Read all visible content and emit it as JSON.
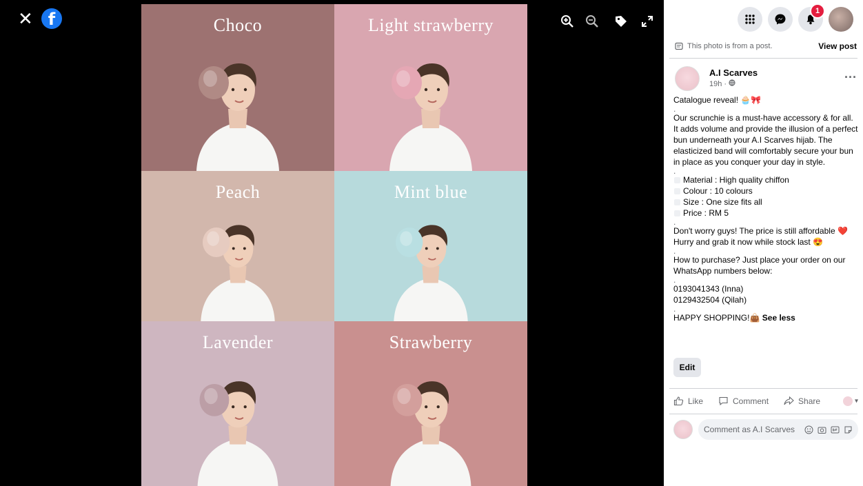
{
  "viewer": {
    "close_icon": "close-icon",
    "logo_icon": "facebook-logo",
    "logo_letter": "f",
    "tools": [
      "zoom-in-icon",
      "zoom-out-icon",
      "tag-icon",
      "fullscreen-icon"
    ]
  },
  "photo": {
    "tiles": [
      {
        "label": "Choco",
        "bg": "#9d7271",
        "scarf": "#b08a85"
      },
      {
        "label": "Light strawberry",
        "bg": "#d9a6b0",
        "scarf": "#e5a7b4"
      },
      {
        "label": "Peach",
        "bg": "#d2b7ac",
        "scarf": "#e6cbc0"
      },
      {
        "label": "Mint blue",
        "bg": "#b7dadc",
        "scarf": "#b9dfe2"
      },
      {
        "label": "Lavender",
        "bg": "#ceb6c0",
        "scarf": "#bc9ea6"
      },
      {
        "label": "Strawberry",
        "bg": "#c9908f",
        "scarf": "#d39f9c"
      }
    ]
  },
  "header": {
    "notification_count": "1"
  },
  "post": {
    "notice": "This photo is from a post.",
    "view_post": "View post",
    "author": "A.I Scarves",
    "time": "19h ·",
    "more": "···",
    "headline": "Catalogue reveal! 🧁🎀",
    "dot": ".",
    "description": "Our scrunchie is a must-have accessory & for all. It adds volume and provide the illusion of a perfect bun underneath your A.I Scarves hijab. The elasticized band will comfortably secure your bun in place as you conquer your day in style.",
    "specs": [
      "Material : High quality chiffon",
      "Colour : 10 colours",
      "Size : One size fits all",
      "Price : RM 5"
    ],
    "price_note": "Don't worry guys! The price is still affordable ❤️",
    "hurry": "Hurry and grab it now while stock last 😍",
    "purchase": "How to purchase? Just place your order on our WhatsApp numbers below:",
    "phone1": "0193041343 (Inna)",
    "phone2": "0129432504 (Qilah)",
    "closing": "HAPPY SHOPPING!👜",
    "see_less": "See less",
    "edit": "Edit",
    "like": "Like",
    "comment": "Comment",
    "share": "Share",
    "comment_placeholder": "Comment as A.I Scarves"
  }
}
